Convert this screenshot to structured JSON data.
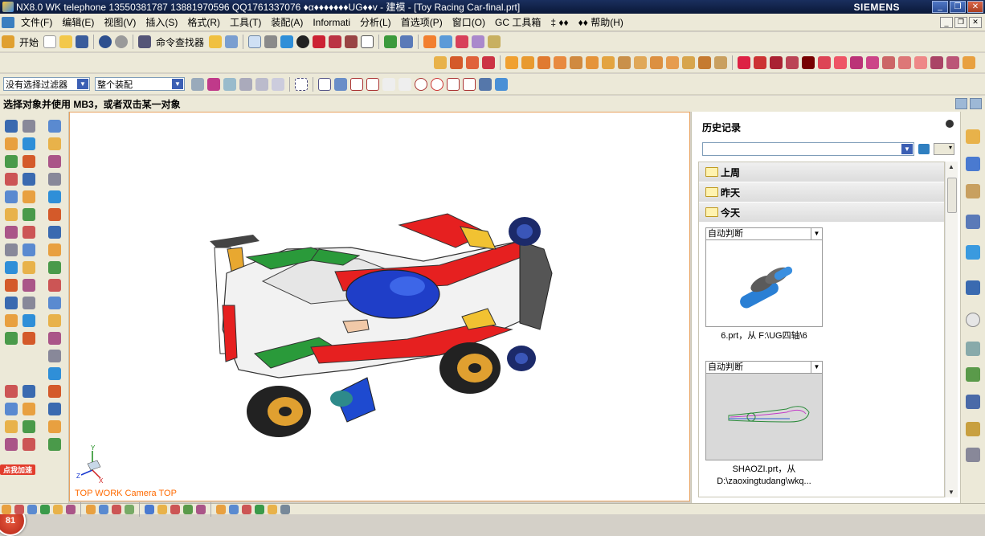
{
  "window": {
    "title": "NX8.0  WK     telephone  13550381787     13881970596  QQ1761337076     ♦α♦♦♦♦♦♦♦UG♦♦v - 建模 - [Toy Racing Car-final.prt]",
    "brand": "SIEMENS",
    "controls": [
      "_",
      "❐",
      "✕"
    ]
  },
  "menu": {
    "items": [
      "文件(F)",
      "编辑(E)",
      "视图(V)",
      "插入(S)",
      "格式(R)",
      "工具(T)",
      "装配(A)",
      "Informati",
      "分析(L)",
      "首选项(P)",
      "窗口(O)",
      "GC 工具箱",
      "‡ ♦♦",
      "♦♦  帮助(H)"
    ]
  },
  "toolbar1": {
    "start_label": "开始",
    "command_finder_label": "命令查找器"
  },
  "selectionbar": {
    "filter_value": "没有选择过滤器",
    "scope_value": "整个装配"
  },
  "status": {
    "prompt": "选择对象并使用 MB3，或者双击某一对象"
  },
  "leftbar": {
    "accelerate_badge": "点我加速",
    "counter_badge": "81"
  },
  "viewport": {
    "view_label": "TOP WORK Camera TOP",
    "axis_labels": {
      "x": "X",
      "y": "Y",
      "z": "Z"
    }
  },
  "history": {
    "title": "历史记录",
    "groups": [
      "上周",
      "昨天",
      "今天"
    ],
    "entries": [
      {
        "mode": "自动判断",
        "caption": "6.prt，从 F:\\UG四轴\\6"
      },
      {
        "mode": "自动判断",
        "caption": "SHAOZI.prt，从 D:\\zaoxingtudang\\wkq..."
      }
    ]
  },
  "colors": {
    "title_bg": "#0a1838",
    "chrome_bg": "#ece9d8",
    "viewport_border": "#e8a15f",
    "view_label": "#ff6a00",
    "badge_red": "#e23d2d"
  }
}
